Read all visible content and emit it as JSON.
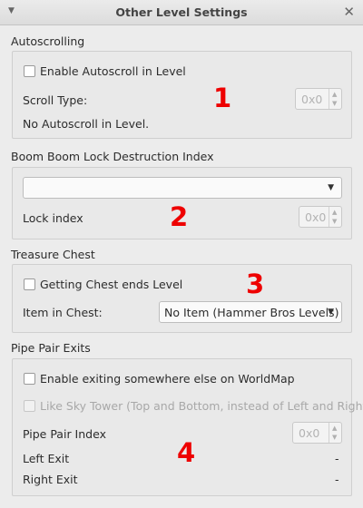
{
  "window": {
    "title": "Other Level Settings"
  },
  "autoscroll": {
    "section_title": "Autoscrolling",
    "enable_label": "Enable Autoscroll in Level",
    "scroll_type_label": "Scroll Type:",
    "scroll_type_value": "0x0",
    "status_text": "No Autoscroll in Level.",
    "marker": "1"
  },
  "boomboom": {
    "section_title": "Boom Boom Lock Destruction Index",
    "combo_value": "",
    "lock_index_label": "Lock index",
    "lock_index_value": "0x0",
    "marker": "2"
  },
  "treasure": {
    "section_title": "Treasure Chest",
    "chest_ends_label": "Getting Chest ends Level",
    "item_label": "Item in Chest:",
    "item_value": "No Item (Hammer Bros Levels)",
    "marker": "3"
  },
  "pipes": {
    "section_title": "Pipe Pair Exits",
    "enable_exit_label": "Enable exiting somewhere else on WorldMap",
    "sky_tower_label": "Like Sky Tower (Top and Bottom, instead of Left and Right)",
    "pipe_index_label": "Pipe Pair Index",
    "pipe_index_value": "0x0",
    "left_exit_label": "Left Exit",
    "left_exit_value": "-",
    "right_exit_label": "Right Exit",
    "right_exit_value": "-",
    "marker": "4"
  },
  "colors": {
    "marker": "#ee0000",
    "background": "#ececec"
  }
}
